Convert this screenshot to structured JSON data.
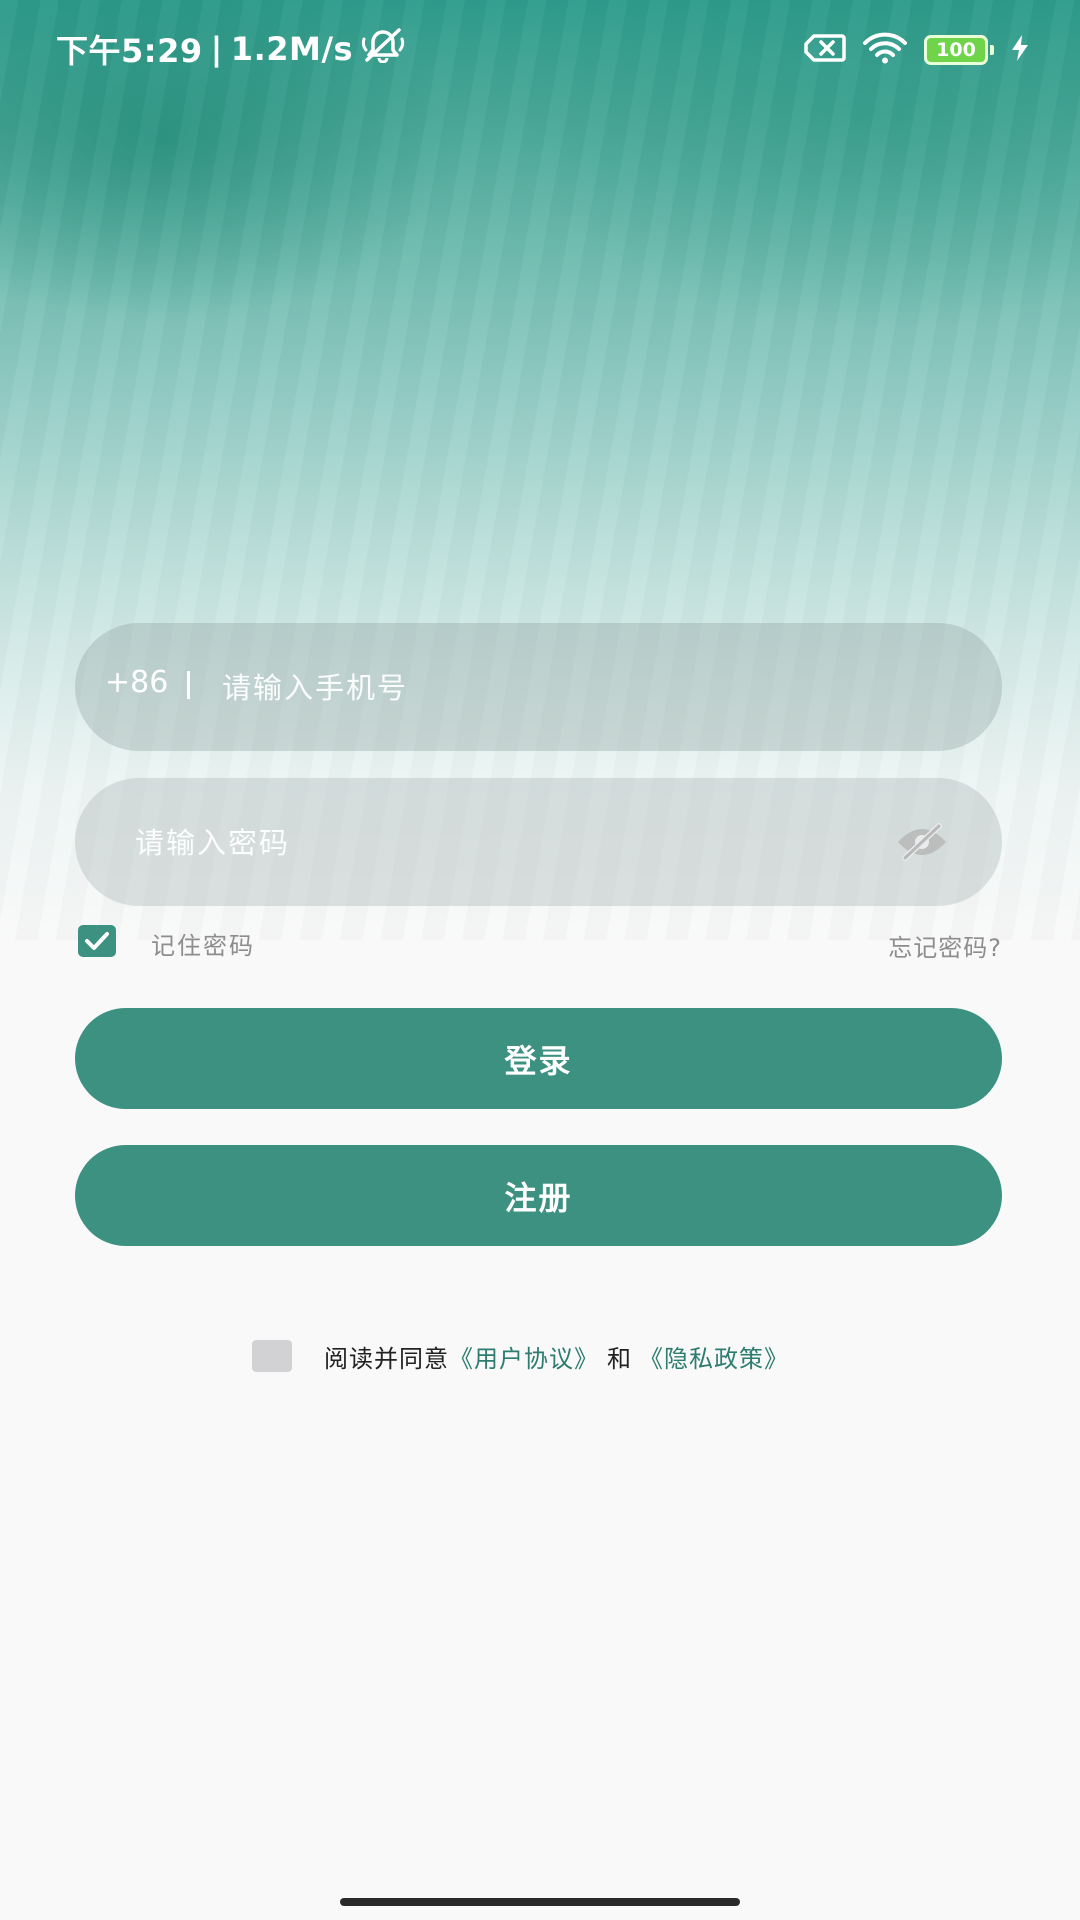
{
  "status_bar": {
    "time": "下午5:29",
    "separator": "|",
    "net_speed": "1.2M/s",
    "battery_level": "100",
    "icons": [
      "alarm-off-icon",
      "sim-card-off-icon",
      "wifi-icon",
      "battery-icon",
      "charging-icon"
    ]
  },
  "login_form": {
    "country_code": "+86",
    "phone_placeholder": "请输入手机号",
    "password_placeholder": "请输入密码",
    "remember_label": "记住密码",
    "remember_checked": true,
    "forgot_label": "忘记密码?",
    "login_label": "登录",
    "register_label": "注册"
  },
  "agreement": {
    "prefix": "阅读并同意",
    "user_agreement": "《用户协议》",
    "and": "和",
    "privacy_policy": "《隐私政策》",
    "checked": false
  },
  "colors": {
    "accent": "#3c9181",
    "link": "#2d7c70",
    "muted_text": "#8d8d8d",
    "unchecked_box": "#d2d2d4"
  }
}
